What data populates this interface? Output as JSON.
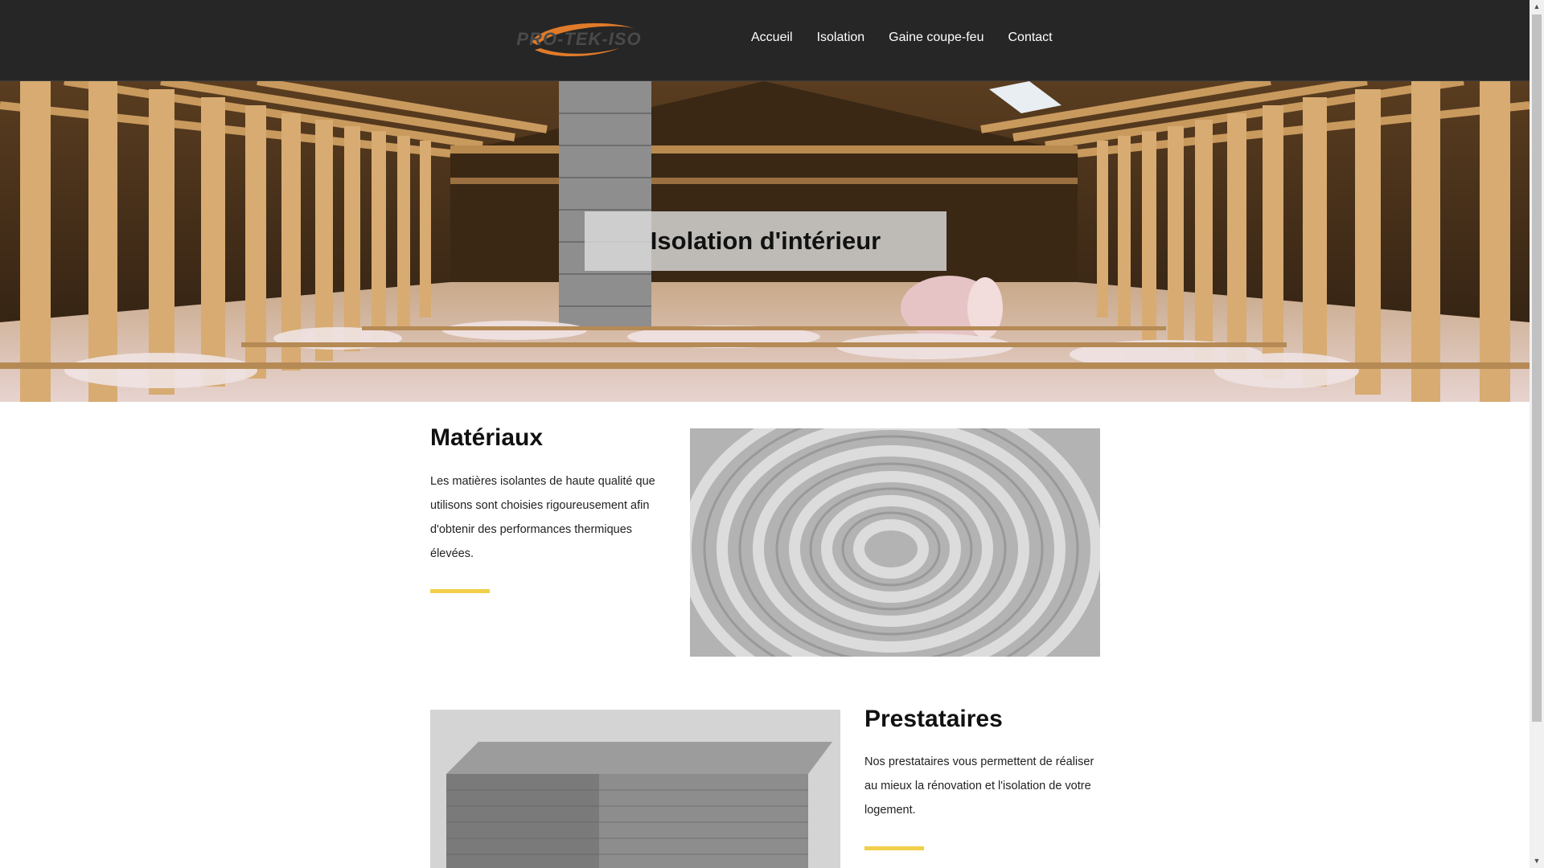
{
  "header": {
    "logo_text": "PRO-TEK-ISO",
    "nav": [
      "Accueil",
      "Isolation",
      "Gaine coupe-feu",
      "Contact"
    ]
  },
  "hero": {
    "title": "Isolation d'intérieur"
  },
  "sections": [
    {
      "title": "Matériaux",
      "text": "Les matières isolantes de haute qualité que utilisons sont choisies rigoureusement afin d'obtenir des performances thermiques élevées."
    },
    {
      "title": "Prestataires",
      "text": "Nos prestataires vous permettent de réaliser au mieux la rénovation et l'isolation de votre logement."
    }
  ],
  "colors": {
    "header_bg": "#262626",
    "accent": "#f2cf4a",
    "logo_swoosh": "#e07b2a"
  },
  "icons": [
    "scroll-up-arrow-icon",
    "scroll-down-arrow-icon"
  ]
}
